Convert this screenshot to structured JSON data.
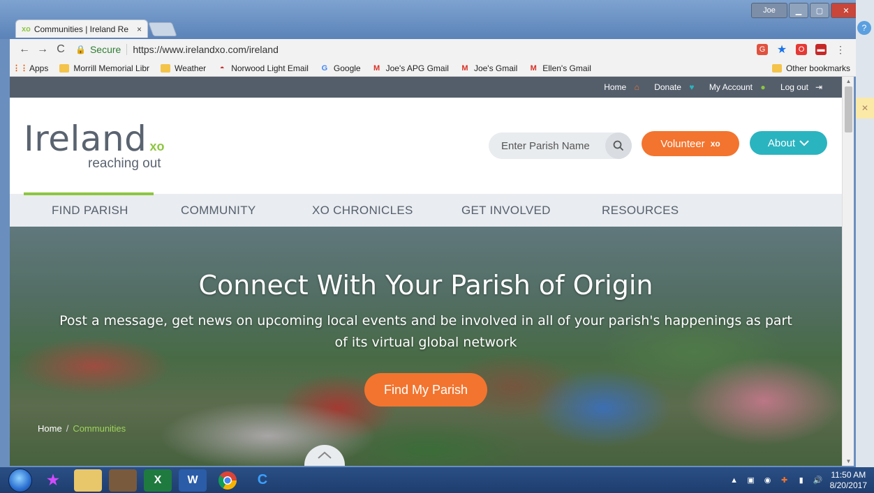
{
  "browser": {
    "tab_title": "Communities | Ireland Re",
    "tab_logo": "xo",
    "tab_close": "×",
    "window_user": "Joe",
    "secure_label": "Secure",
    "url": "https://www.irelandxo.com/ireland",
    "bookmarks": [
      {
        "label": "Apps",
        "icon": "apps-icon"
      },
      {
        "label": "Morrill Memorial Libr",
        "icon": "folder-icon"
      },
      {
        "label": "Weather",
        "icon": "folder-icon"
      },
      {
        "label": "Norwood Light Email",
        "icon": "red-hat-icon"
      },
      {
        "label": "Google",
        "icon": "google-icon"
      },
      {
        "label": "Joe's APG Gmail",
        "icon": "gmail-icon"
      },
      {
        "label": "Joe's Gmail",
        "icon": "gmail-icon"
      },
      {
        "label": "Ellen's Gmail",
        "icon": "gmail-icon"
      }
    ],
    "other_bookmarks": "Other bookmarks"
  },
  "site": {
    "topbar": {
      "home": "Home",
      "donate": "Donate",
      "account": "My Account",
      "logout": "Log out"
    },
    "logo": {
      "name": "Ireland",
      "xo": "xo",
      "tagline": "reaching out"
    },
    "search_placeholder": "Enter Parish Name",
    "volunteer_label": "Volunteer",
    "volunteer_xo": "xo",
    "about_label": "About",
    "nav": [
      "FIND PARISH",
      "COMMUNITY",
      "XO CHRONICLES",
      "GET INVOLVED",
      "RESOURCES"
    ],
    "hero": {
      "title": "Connect With Your Parish of Origin",
      "subtitle": "Post a message, get news on upcoming local events and be involved in all of your parish's happenings as part of its virtual global network",
      "cta": "Find My Parish"
    },
    "breadcrumb": {
      "home": "Home",
      "separator": "/",
      "current": "Communities"
    }
  },
  "taskbar": {
    "time": "11:50 AM",
    "date": "8/20/2017"
  },
  "colors": {
    "brand_green": "#8dc63f",
    "orange": "#f3742e",
    "teal": "#2ab4c0",
    "topbar": "#545e6b"
  }
}
